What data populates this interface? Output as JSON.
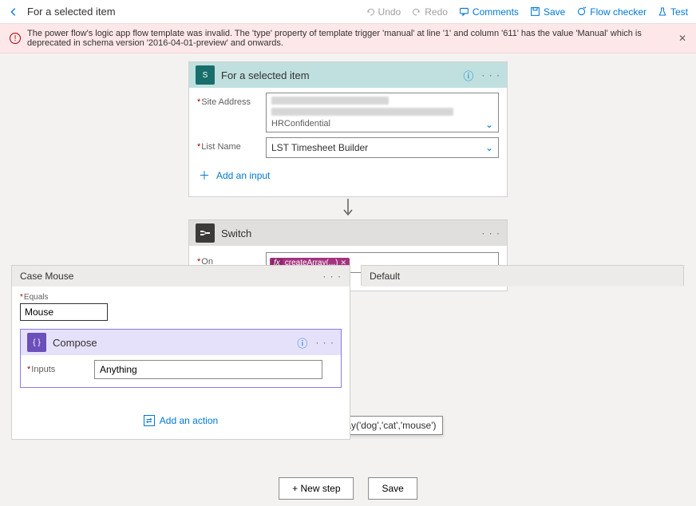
{
  "toolbar": {
    "title": "For a selected item",
    "undo": "Undo",
    "redo": "Redo",
    "comments": "Comments",
    "save": "Save",
    "flow_checker": "Flow checker",
    "test": "Test"
  },
  "error": {
    "message": "The power flow's logic app flow template was invalid. The 'type' property of template trigger 'manual' at line '1' and column '611' has the value 'Manual' which is deprecated in schema version '2016-04-01-preview' and onwards."
  },
  "trigger": {
    "title": "For a selected item",
    "site_label": "Site Address",
    "site_sublabel": "HRConfidential",
    "list_label": "List Name",
    "list_value": "LST Timesheet Builder",
    "add_input": "Add an input"
  },
  "switch": {
    "title": "Switch",
    "on_label": "On",
    "token_label": "createArray(...)",
    "tooltip": "createArray('dog','cat','mouse')"
  },
  "case": {
    "header": "Case Mouse",
    "equals_label": "Equals",
    "equals_value": "Mouse",
    "compose_title": "Compose",
    "inputs_label": "Inputs",
    "inputs_value": "Anything",
    "add_action": "Add an action"
  },
  "default": {
    "header": "Default"
  },
  "footer": {
    "new_step": "+ New step",
    "save": "Save"
  }
}
